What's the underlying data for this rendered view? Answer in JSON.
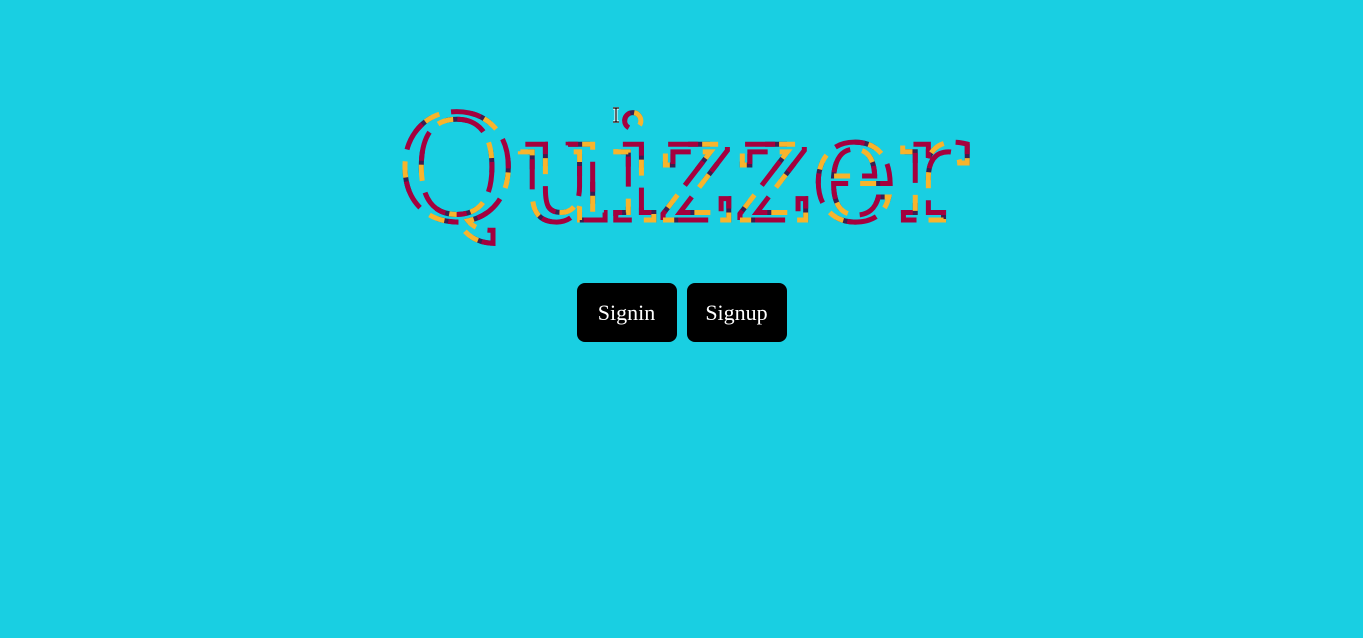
{
  "logo": {
    "text": "Quizzer",
    "colors": [
      "#a4003e",
      "#f8b42c",
      "#3a1f4f"
    ]
  },
  "buttons": {
    "signin_label": "Signin",
    "signup_label": "Signup"
  },
  "colors": {
    "background": "#19cfe2",
    "button_bg": "#000000",
    "button_text": "#ffffff"
  },
  "cursor": {
    "icon": "text-cursor-icon"
  }
}
